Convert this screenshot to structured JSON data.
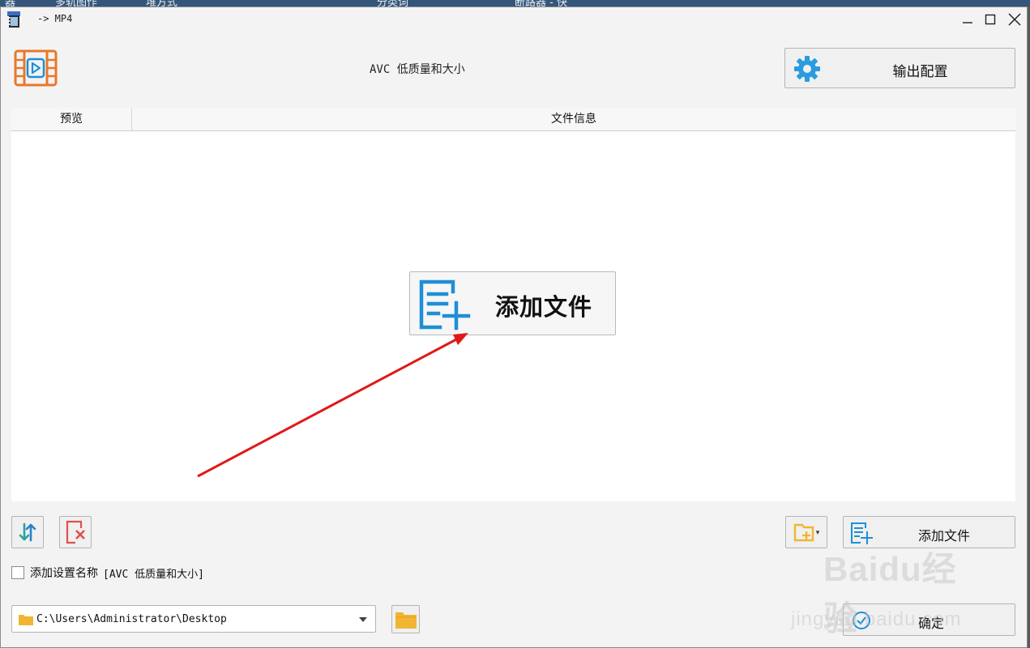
{
  "background_window": {
    "fragments": [
      "器",
      "多轨图作",
      "堆方式",
      "分类词",
      "断路器 - 快"
    ]
  },
  "window": {
    "title": "-> MP4",
    "controls": {
      "minimize": "—",
      "maximize": "☐",
      "close": "✕"
    }
  },
  "header": {
    "preset_title": "AVC 低质量和大小",
    "output_config_label": "输出配置"
  },
  "file_list": {
    "columns": [
      "预览",
      "文件信息"
    ],
    "add_file_big_label": "添加文件"
  },
  "toolbar": {
    "add_files_label": "添加文件",
    "add_folder_dropdown": "▾",
    "checkbox_label": "添加设置名称",
    "checkbox_preset": "[AVC 低质量和大小]",
    "checkbox_checked": false,
    "output_path": "C:\\Users\\Administrator\\Desktop",
    "ok_label": "确定"
  },
  "watermark": {
    "text": "Baidu经验",
    "sub": "jingyan.baidu.com"
  },
  "colors": {
    "accent_blue": "#1e8fd6",
    "logo_orange": "#e8782a",
    "folder_yellow": "#f2b531",
    "clear_red": "#e05050",
    "annotation_red": "#e01818"
  }
}
